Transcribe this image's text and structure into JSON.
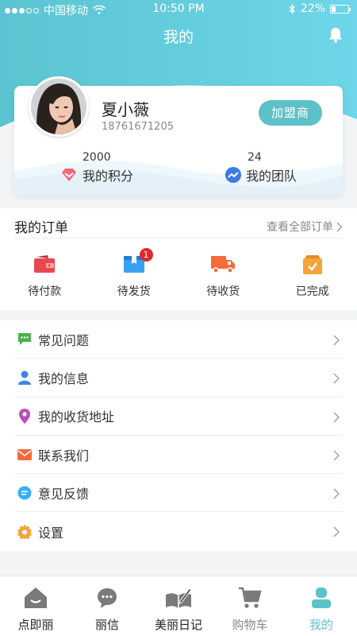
{
  "status_bar": {
    "carrier": "中国移动",
    "time": "10:50 PM",
    "battery": "22%"
  },
  "header": {
    "title": "我的"
  },
  "profile": {
    "name": "夏小薇",
    "phone": "18761671205",
    "join_label": "加盟商",
    "points_value": "2000",
    "points_label": "我的积分",
    "team_value": "24",
    "team_label": "我的团队"
  },
  "orders": {
    "title": "我的订单",
    "view_all": "查看全部订单",
    "items": [
      {
        "label": "待付款",
        "icon": "wallet-icon",
        "color": "#e8474f"
      },
      {
        "label": "待发货",
        "icon": "package-icon",
        "color": "#3aa0f2",
        "badge": "1"
      },
      {
        "label": "待收货",
        "icon": "truck-icon",
        "color": "#f36b3b"
      },
      {
        "label": "已完成",
        "icon": "box-check-icon",
        "color": "#f5a43a"
      }
    ]
  },
  "menu": {
    "items": [
      {
        "label": "常见问题",
        "icon": "chat-icon",
        "color": "#4caf50"
      },
      {
        "label": "我的信息",
        "icon": "person-icon",
        "color": "#3a86e8"
      },
      {
        "label": "我的收货地址",
        "icon": "location-icon",
        "color": "#b84fb8"
      },
      {
        "label": "联系我们",
        "icon": "mail-icon",
        "color": "#f36b3b"
      },
      {
        "label": "意见反馈",
        "icon": "feedback-icon",
        "color": "#3ab0f2"
      },
      {
        "label": "设置",
        "icon": "gear-icon",
        "color": "#f5a43a"
      }
    ]
  },
  "tabbar": {
    "items": [
      {
        "label": "点即丽",
        "icon": "home-icon"
      },
      {
        "label": "丽信",
        "icon": "message-icon"
      },
      {
        "label": "美丽日记",
        "icon": "diary-icon"
      },
      {
        "label": "购物车",
        "icon": "cart-icon"
      },
      {
        "label": "我的",
        "icon": "user-icon"
      }
    ],
    "active": "我的",
    "accent": "#5cc1c9"
  }
}
